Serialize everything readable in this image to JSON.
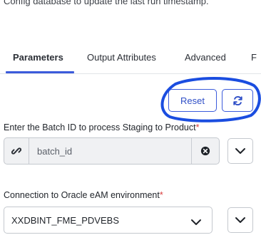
{
  "intro_text": "Config database to update the last run timestamp.",
  "tabs": [
    {
      "label": "Parameters",
      "active": true
    },
    {
      "label": "Output Attributes",
      "active": false
    },
    {
      "label": "Advanced",
      "active": false
    },
    {
      "label": "F",
      "active": false
    }
  ],
  "actions": {
    "reset_label": "Reset",
    "refresh_icon": "refresh-icon"
  },
  "batch_field": {
    "label": "Enter the Batch ID to process Staging to Product",
    "required_mark": "*",
    "value": "batch_id",
    "left_icon": "link-icon",
    "clear_icon": "clear-circle-icon",
    "dropdown_icon": "chevron-down-icon"
  },
  "connection_field": {
    "label": "Connection to Oracle eAM environment",
    "required_mark": "*",
    "value": "XXDBINT_FME_PDVEBS",
    "dropdown_icon": "chevron-down-icon"
  },
  "colors": {
    "accent": "#3b5bdb",
    "required": "#d93d3d",
    "annotation": "#1a4de0"
  }
}
